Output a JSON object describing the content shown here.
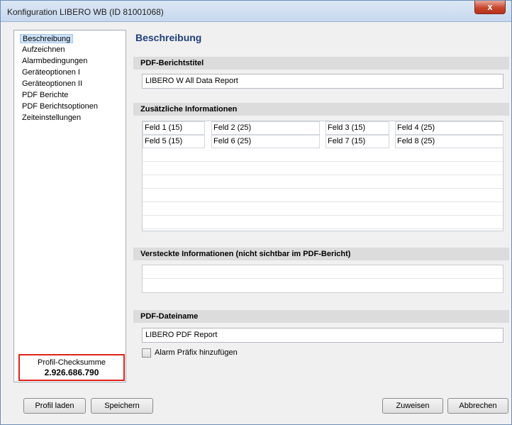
{
  "window": {
    "title": "Konfiguration LIBERO WB (ID 81001068)",
    "close_glyph": "x"
  },
  "sidebar": {
    "items": [
      {
        "label": "Beschreibung",
        "selected": true
      },
      {
        "label": "Aufzeichnen"
      },
      {
        "label": "Alarmbedingungen"
      },
      {
        "label": "Geräteoptionen I"
      },
      {
        "label": "Geräteoptionen II"
      },
      {
        "label": "PDF Berichte"
      },
      {
        "label": "PDF Berichtsoptionen"
      },
      {
        "label": "Zeiteinstellungen"
      }
    ],
    "checksum_label": "Profil-Checksumme",
    "checksum_value": "2.926.686.790"
  },
  "main": {
    "title": "Beschreibung",
    "report_title_header": "PDF-Berichtstitel",
    "report_title_value": "LIBERO W All Data Report",
    "additional_info_header": "Zusätzliche Informationen",
    "fields": [
      "Feld 1 (15)",
      "Feld 2 (25)",
      "Feld 3 (15)",
      "Feld 4 (25)",
      "Feld 5 (15)",
      "Feld 6 (25)",
      "Feld 7 (15)",
      "Feld 8 (25)"
    ],
    "hidden_info_header": "Versteckte Informationen (nicht sichtbar im PDF-Bericht)",
    "filename_header": "PDF-Dateiname",
    "filename_value": "LIBERO PDF Report",
    "alarm_prefix_label": "Alarm Präfix hinzufügen",
    "alarm_prefix_checked": false
  },
  "buttons": {
    "load_profile": "Profil laden",
    "save": "Speichern",
    "assign": "Zuweisen",
    "cancel": "Abbrechen"
  }
}
